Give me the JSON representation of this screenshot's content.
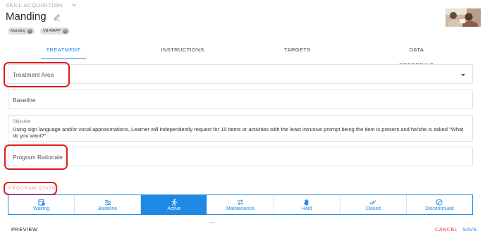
{
  "breadcrumb": {
    "label": "SKILL ACQUISITION"
  },
  "header": {
    "title": "Manding"
  },
  "tags": [
    "Manding",
    "VB-MAPP"
  ],
  "tabs": [
    {
      "label": "TREATMENT",
      "active": true
    },
    {
      "label": "INSTRUCTIONS",
      "active": false
    },
    {
      "label": "TARGETS",
      "active": false
    },
    {
      "label": "DATA RECORDING",
      "active": false
    }
  ],
  "form": {
    "treatment_area": {
      "placeholder": "Treatment Area"
    },
    "baseline": {
      "placeholder": "Baseline"
    },
    "objective": {
      "label": "Objective",
      "value": "Using sign language and/or vocal approximations, Learner will independently request for 10 items or activities with the least intrusive prompt being the item is present and he/she is asked \"What do you want?\"."
    },
    "program_rationale": {
      "placeholder": "Program Rationale"
    }
  },
  "program_status": {
    "label": "PROGRAM STATUS",
    "options": [
      {
        "label": "Waiting",
        "icon": "hourglass-calendar-icon"
      },
      {
        "label": "Baseline",
        "icon": "baseline-icon"
      },
      {
        "label": "Active",
        "icon": "running-person-icon",
        "selected": true
      },
      {
        "label": "Maintenance",
        "icon": "repeat-icon"
      },
      {
        "label": "Hold",
        "icon": "hand-icon"
      },
      {
        "label": "Closed",
        "icon": "double-check-icon"
      },
      {
        "label": "Discontinued",
        "icon": "block-icon"
      }
    ]
  },
  "footer": {
    "preview": "PREVIEW",
    "cancel": "CANCEL",
    "save": "SAVE"
  },
  "colors": {
    "accent": "#1e88e5",
    "danger": "#e53935",
    "highlight": "#e01b1b"
  }
}
